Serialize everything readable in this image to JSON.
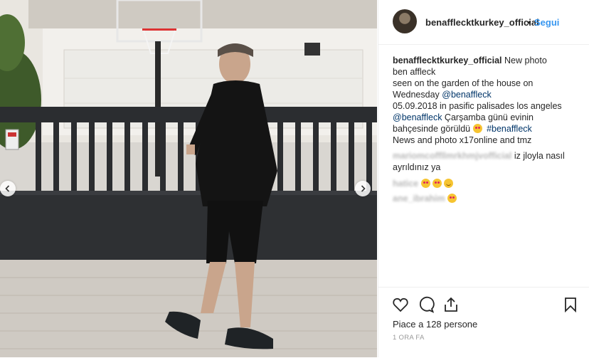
{
  "post": {
    "username": "benafflecktkurkey_official",
    "follow_label": "Segui",
    "separator": "•"
  },
  "caption": {
    "username": "benafflecktkurkey_official",
    "lines": [
      "New photo",
      "ben affleck",
      "seen on the garden of the house on",
      "Wednesday "
    ],
    "mention1": "@benaffleck",
    "date_line": "05.09.2018 in pasific palisades los angeles",
    "mention2": "@benaffleck",
    "turkish_1": " Çarşamba günü evinin",
    "turkish_2": "bahçesinde görüldü ",
    "hashtag": "#benaffleck",
    "credit": "News and photo x17online and tmz"
  },
  "comments": [
    {
      "user": "mariomcoffllmrkhmjvofficial",
      "text": "iz jloyla nasıl",
      "text2": "ayrıldınız ya"
    },
    {
      "user": "hatice",
      "text": ""
    },
    {
      "user": "ane_ibrahim",
      "text": ""
    }
  ],
  "actions": {
    "likes": "Piace a 128 persone",
    "time": "1 ORA FA"
  },
  "icons": [
    "heart-icon",
    "comment-icon",
    "share-icon",
    "bookmark-icon",
    "chevron-left-icon",
    "chevron-right-icon"
  ]
}
